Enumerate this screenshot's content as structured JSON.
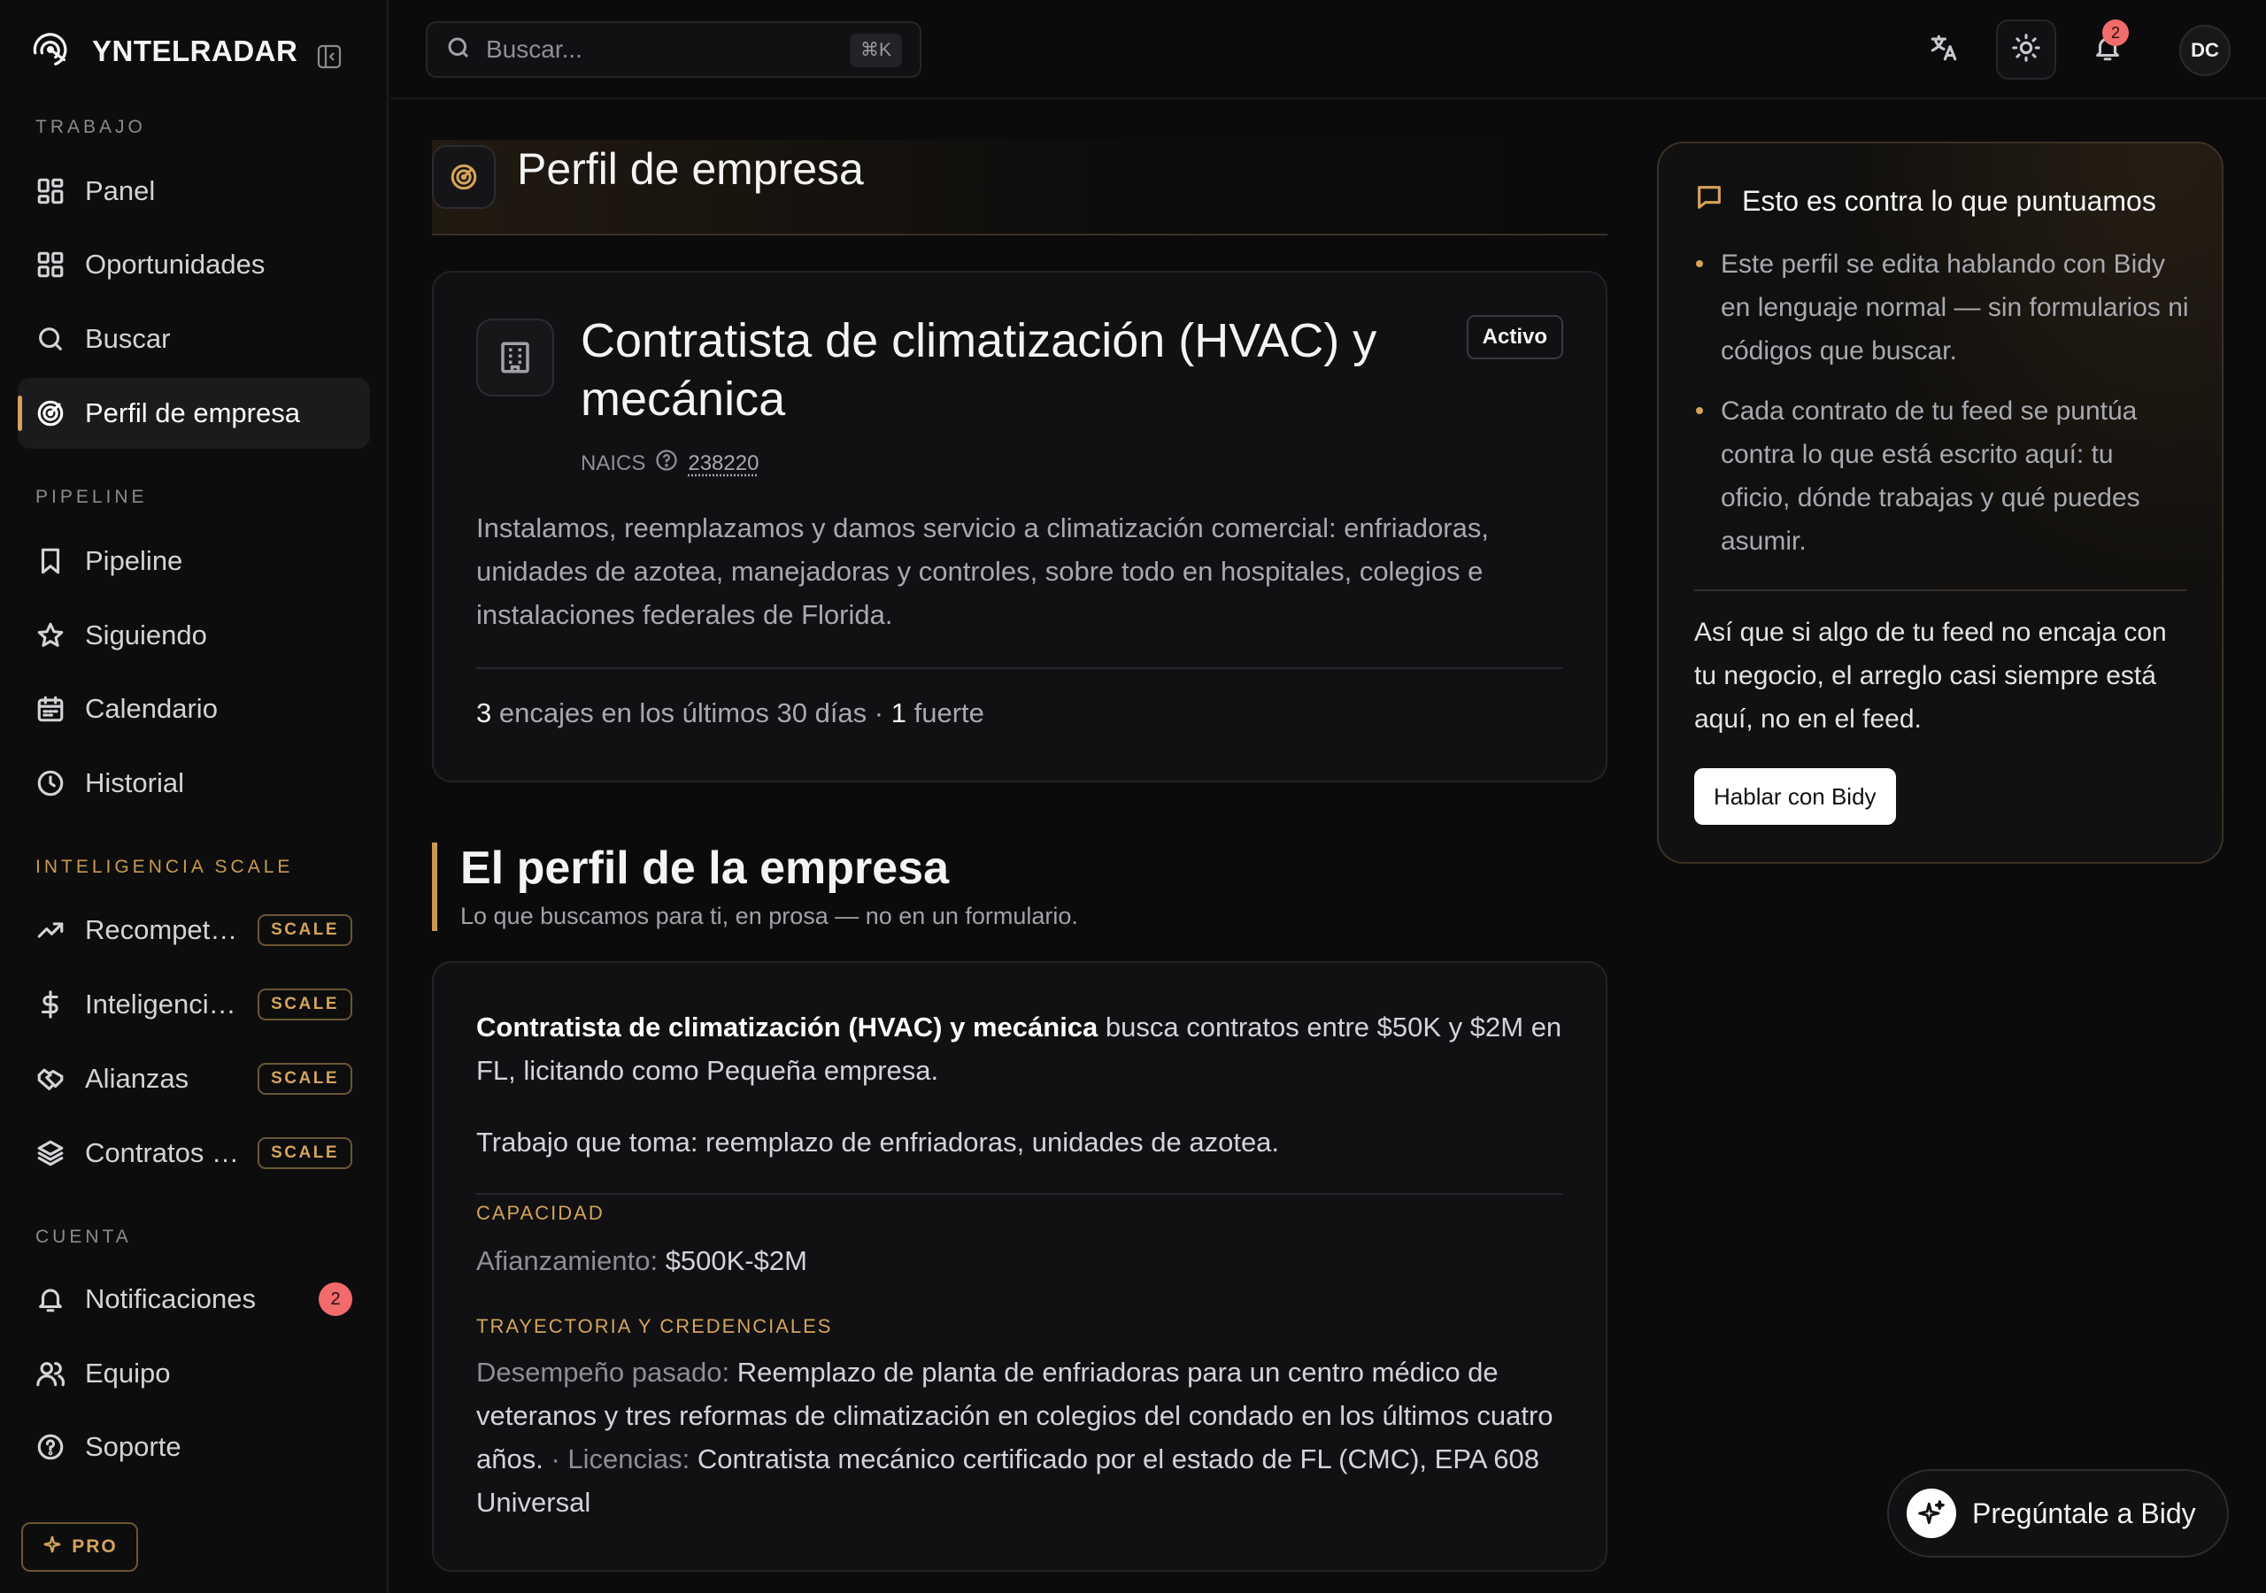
{
  "app": {
    "name": "YNTELRADAR"
  },
  "sidebar": {
    "sections": [
      {
        "label": "TRABAJO",
        "items": [
          {
            "label": "Panel",
            "icon": "dashboard-icon"
          },
          {
            "label": "Oportunidades",
            "icon": "grid-icon"
          },
          {
            "label": "Buscar",
            "icon": "search-icon"
          },
          {
            "label": "Perfil de empresa",
            "icon": "radar-icon",
            "active": true
          }
        ]
      },
      {
        "label": "PIPELINE",
        "items": [
          {
            "label": "Pipeline",
            "icon": "bookmark-icon"
          },
          {
            "label": "Siguiendo",
            "icon": "star-icon"
          },
          {
            "label": "Calendario",
            "icon": "calendar-icon"
          },
          {
            "label": "Historial",
            "icon": "clock-icon"
          }
        ]
      },
      {
        "label": "INTELIGENCIA SCALE",
        "items": [
          {
            "label": "Recompetencias",
            "icon": "trend-icon",
            "badge": "SCALE"
          },
          {
            "label": "Inteligencia de precios",
            "icon": "dollar-icon",
            "badge": "SCALE"
          },
          {
            "label": "Alianzas",
            "icon": "handshake-icon",
            "badge": "SCALE"
          },
          {
            "label": "Contratos principales",
            "icon": "layers-icon",
            "badge": "SCALE"
          }
        ]
      },
      {
        "label": "CUENTA",
        "items": [
          {
            "label": "Notificaciones",
            "icon": "bell-icon",
            "count": "2"
          },
          {
            "label": "Equipo",
            "icon": "users-icon"
          },
          {
            "label": "Soporte",
            "icon": "help-icon"
          }
        ]
      }
    ],
    "pro_label": "PRO"
  },
  "topbar": {
    "search_placeholder": "Buscar...",
    "search_shortcut": "⌘K",
    "notification_count": "2",
    "avatar_initials": "DC"
  },
  "page": {
    "title": "Perfil de empresa"
  },
  "company": {
    "title": "Contratista de climatización (HVAC) y mecánica",
    "status": "Activo",
    "naics_label": "NAICS",
    "naics_code": "238220",
    "description": "Instalamos, reemplazamos y damos servicio a climatización comercial: enfriadoras, unidades de azotea, manejadoras y controles, sobre todo en hospitales, colegios e instalaciones federales de Florida.",
    "matches_count": "3",
    "matches_text": "encajes en los últimos 30 días ·",
    "strong_count": "1",
    "strong_text": "fuerte"
  },
  "profile_section": {
    "title": "El perfil de la empresa",
    "subtitle": "Lo que buscamos para ti, en prosa — no en un formulario.",
    "lead_bold": "Contratista de climatización (HVAC) y mecánica",
    "lead_rest": "busca contratos entre $50K y $2M en FL, licitando como Pequeña empresa.",
    "work_text": "Trabajo que toma: reemplazo de enfriadoras, unidades de azotea.",
    "capacity_label": "CAPACIDAD",
    "bonding_label": "Afianzamiento:",
    "bonding_value": "$500K-$2M",
    "track_label": "TRAYECTORIA Y CREDENCIALES",
    "past_label": "Desempeño pasado:",
    "past_value": "Reemplazo de planta de enfriadoras para un centro médico de veteranos y tres reformas de climatización en colegios del condado en los últimos cuatro años.",
    "license_sep": "·",
    "license_label": "Licencias:",
    "license_value": "Contratista mecánico certificado por el estado de FL (CMC), EPA 608 Universal"
  },
  "info_panel": {
    "title": "Esto es contra lo que puntuamos",
    "bullets": [
      "Este perfil se edita hablando con Bidy en lenguaje normal — sin formularios ni códigos que buscar.",
      "Cada contrato de tu feed se puntúa contra lo que está escrito aquí: tu oficio, dónde trabajas y qué puedes asumir."
    ],
    "footer": "Así que si algo de tu feed no encaja con tu negocio, el arreglo casi siempre está aquí, no en el feed.",
    "button_label": "Hablar con Bidy"
  },
  "fab": {
    "label": "Pregúntale a Bidy"
  },
  "colors": {
    "accent": "#d6a358",
    "badge_red": "#f26b6b",
    "background": "#0b0b0c"
  }
}
